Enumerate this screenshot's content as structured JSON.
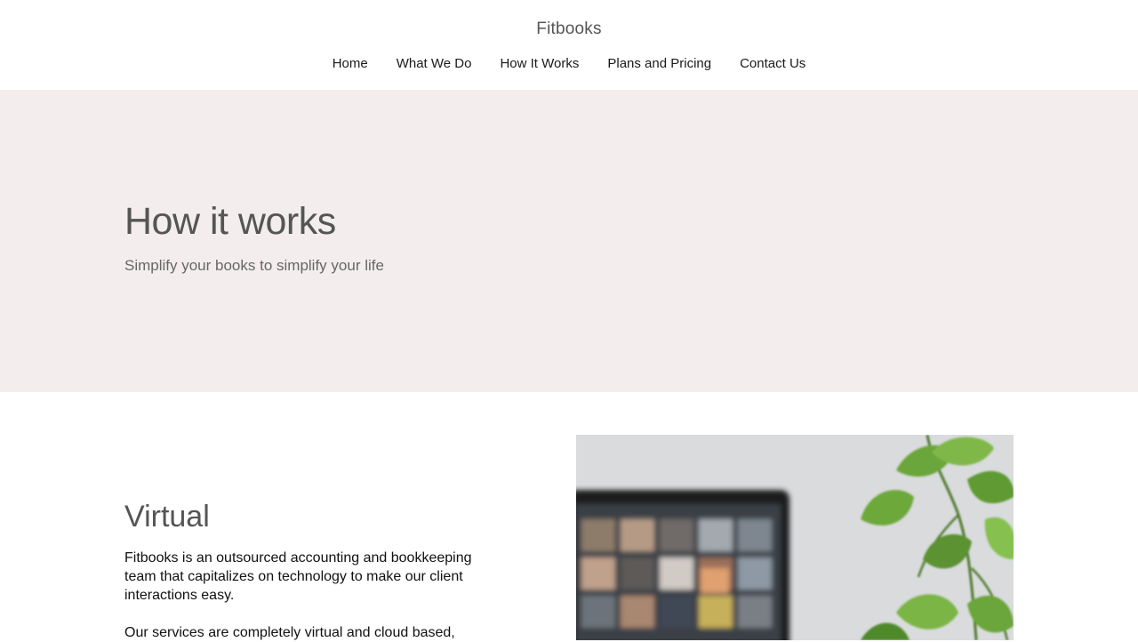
{
  "site": {
    "title": "Fitbooks"
  },
  "nav": {
    "items": [
      {
        "label": "Home"
      },
      {
        "label": "What We Do"
      },
      {
        "label": "How It Works"
      },
      {
        "label": "Plans and Pricing"
      },
      {
        "label": "Contact Us"
      }
    ]
  },
  "hero": {
    "title": "How it works",
    "subtitle": "Simplify your books to simplify your life",
    "background_color": "#f3eeed"
  },
  "section": {
    "title": "Virtual",
    "paragraphs": [
      "Fitbooks is an outsourced accounting and bookkeeping team that capitalizes on technology to make our client interactions easy.",
      "Our services are completely virtual and cloud based,"
    ]
  },
  "image": {
    "icon": "laptop-video-call-with-plant-photo"
  }
}
